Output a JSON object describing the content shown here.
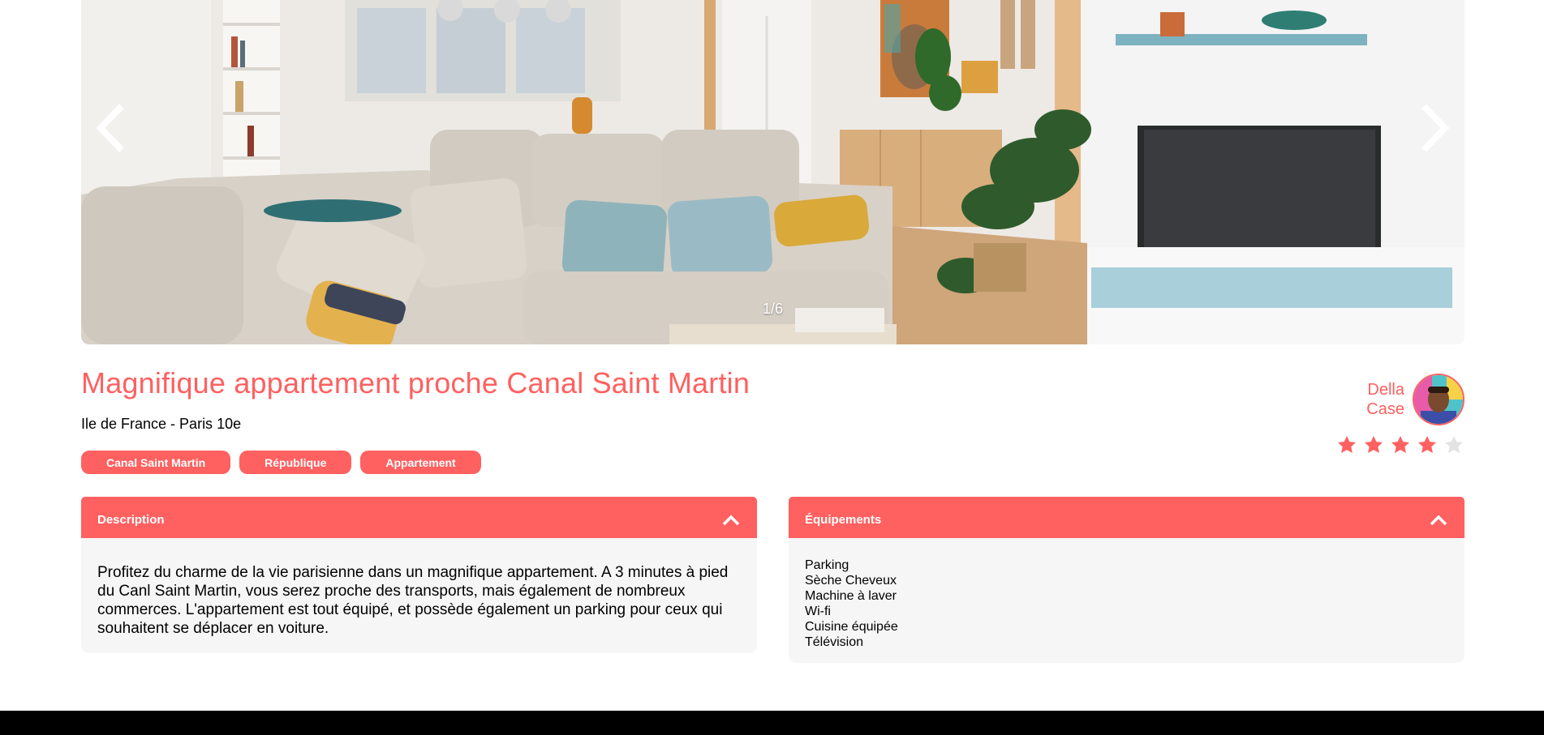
{
  "carousel": {
    "counter": "1/6",
    "prev_icon": "chevron-left-icon",
    "next_icon": "chevron-right-icon"
  },
  "listing": {
    "title": "Magnifique appartement proche Canal Saint Martin",
    "location": "Ile de France - Paris 10e",
    "tags": [
      "Canal Saint Martin",
      "République",
      "Appartement"
    ]
  },
  "host": {
    "first_name": "Della",
    "last_name": "Case"
  },
  "rating": {
    "value": 4,
    "max": 5,
    "active_color": "#FF6060",
    "inactive_color": "#E3E3E3"
  },
  "description": {
    "title": "Description",
    "text": "Profitez du charme de la vie parisienne dans un magnifique appartement. A 3 minutes à pied du Canl Saint Martin, vous serez proche des transports, mais également de nombreux commerces. L'appartement est tout équipé, et possède également un parking pour ceux qui souhaitent se déplacer en voiture."
  },
  "equipments": {
    "title": "Équipements",
    "items": [
      "Parking",
      "Sèche Cheveux",
      "Machine à laver",
      "Wi-fi",
      "Cuisine équipée",
      "Télévision"
    ]
  },
  "colors": {
    "primary": "#FF6060",
    "background_light": "#F6F6F6",
    "footer": "#000000"
  }
}
